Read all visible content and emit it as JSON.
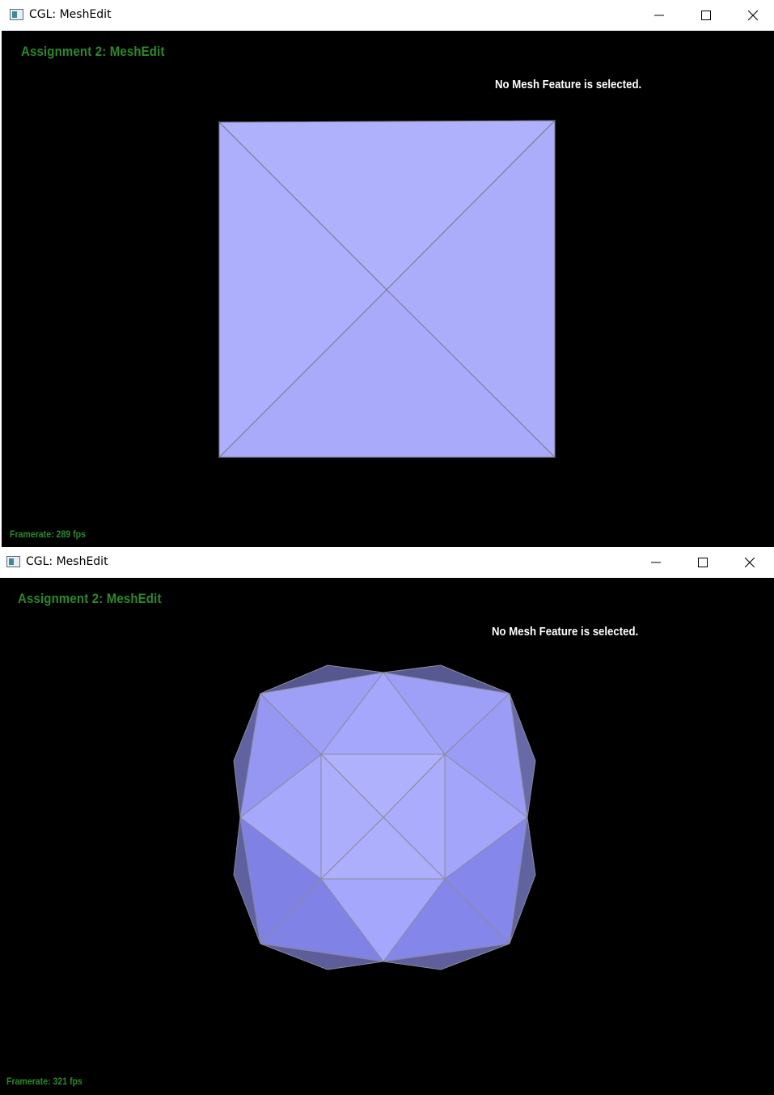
{
  "windows": [
    {
      "title": "CGL: MeshEdit",
      "heading": "Assignment 2: MeshEdit",
      "status": "No Mesh Feature is selected.",
      "framerate": "Framerate: 289 fps",
      "mesh_icon": "subdivided-square-mesh-level-0"
    },
    {
      "title": "CGL: MeshEdit",
      "heading": "Assignment 2: MeshEdit",
      "status": "No Mesh Feature is selected.",
      "framerate": "Framerate: 321 fps",
      "mesh_icon": "subdivided-cube-mesh-level-1"
    }
  ],
  "colors": {
    "mesh_fill": "#aeaffc",
    "mesh_edge": "#8a8a9a",
    "heading_green": "#2a8a2a",
    "viewport_bg": "#000000"
  }
}
